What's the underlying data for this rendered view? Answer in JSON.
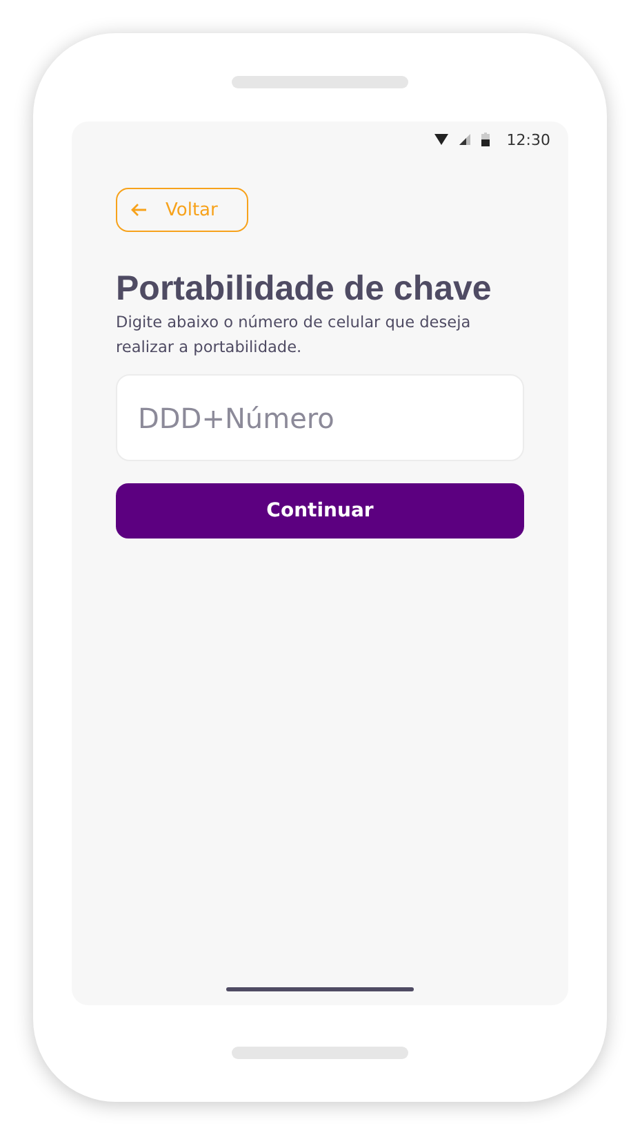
{
  "status_bar": {
    "time": "12:30"
  },
  "back_button": {
    "label": "Voltar"
  },
  "title": "Portabilidade de chave",
  "description": "Digite abaixo o número de celular que deseja realizar a portabilidade.",
  "phone_field": {
    "placeholder": "DDD+Número"
  },
  "continue_button": {
    "label": "Continuar"
  }
}
